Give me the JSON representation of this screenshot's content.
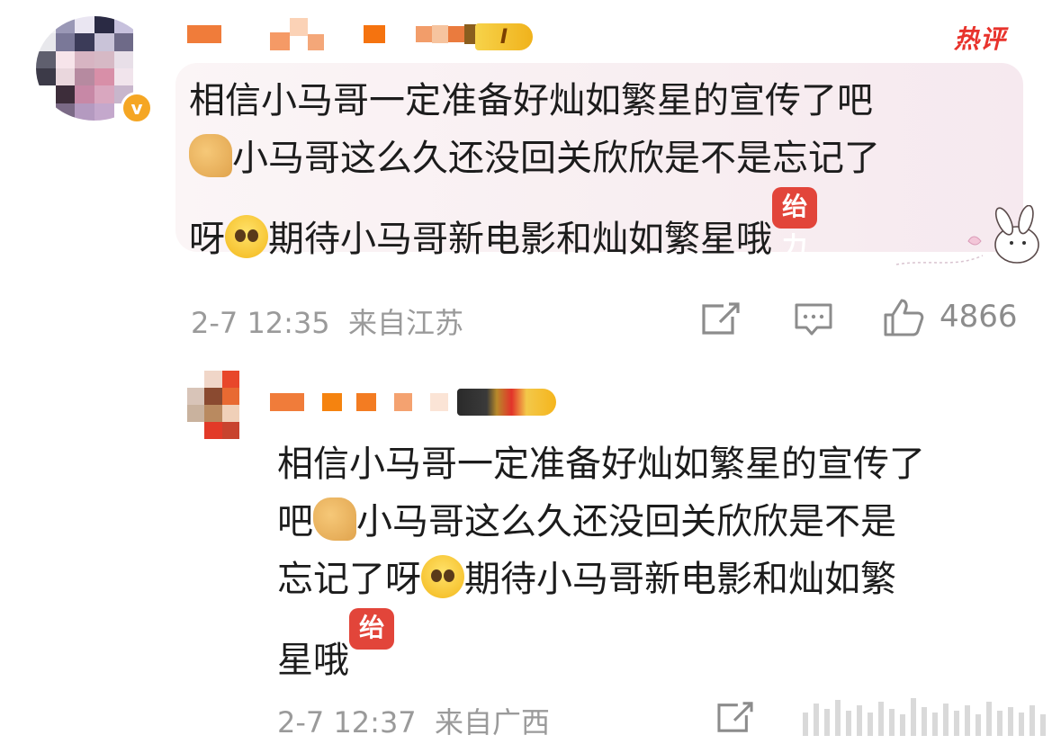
{
  "header": {
    "hot_label": "热评"
  },
  "top_comment": {
    "user_badge_text": "I",
    "verified_mark": "v",
    "text_segments": {
      "line1": "相信小马哥一定准备好灿如繁星的宣传了吧",
      "line2": "小马哥这么久还没回关欣欣是不是忘记了",
      "line3_pre": "呀",
      "line3_post": "期待小马哥新电影和灿如繁星哦",
      "sticker": "绐力"
    },
    "timestamp": "2-7 12:35",
    "location": "来自江苏",
    "like_count": "4866",
    "icons": {
      "share": "share-icon",
      "comment": "comment-icon",
      "like": "thumb-up-icon"
    }
  },
  "reply": {
    "text_segments": {
      "line1": "相信小马哥一定准备好灿如繁星的宣传了",
      "line2_pre": "吧",
      "line2_post": "小马哥这么久还没回关欣欣是不是",
      "line3_pre": "忘记了呀",
      "line3_post": "期待小马哥新电影和灿如繁",
      "line4": "星哦",
      "sticker": "绐力"
    },
    "timestamp": "2-7 12:37",
    "location": "来自广西",
    "icons": {
      "share": "share-icon"
    }
  },
  "colors": {
    "accent_red": "#e8332c",
    "badge_gold": "#f2c230",
    "meta_gray": "#9a9a9a"
  }
}
